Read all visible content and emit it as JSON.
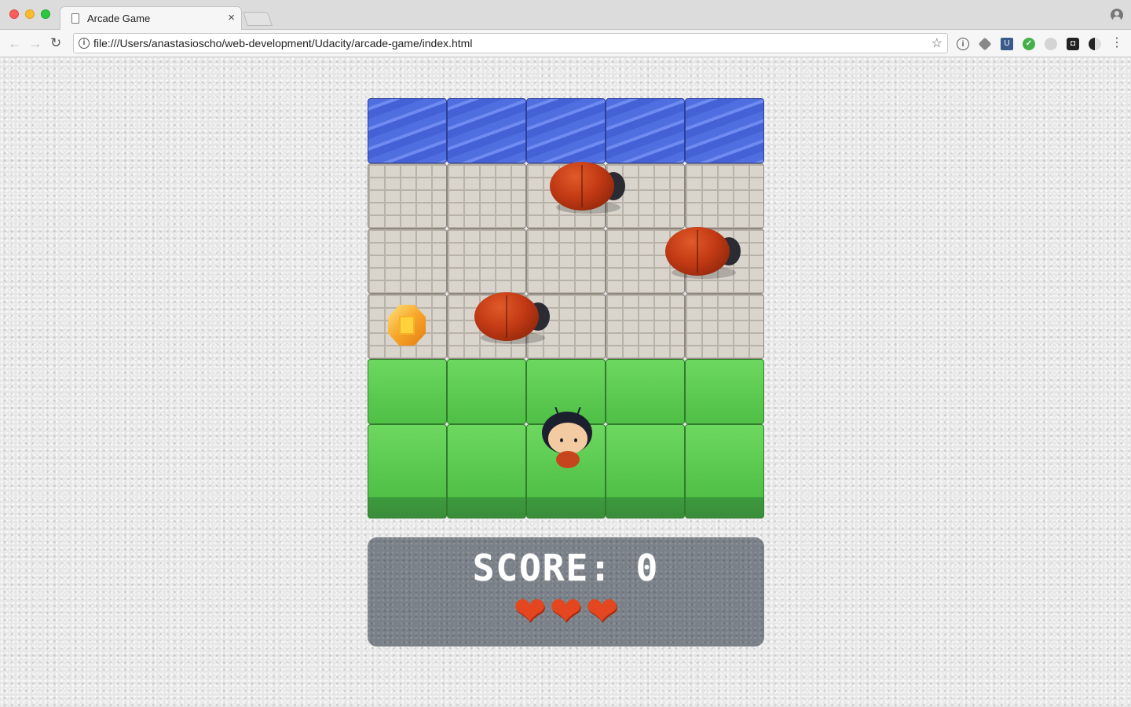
{
  "browser": {
    "tab_title": "Arcade Game",
    "tab_close": "×",
    "url": "file:///Users/anastasioscho/web-development/Udacity/arcade-game/index.html",
    "back_glyph": "←",
    "forward_glyph": "→",
    "reload_glyph": "↻",
    "star_glyph": "☆",
    "menu_glyph": "⋮",
    "info_glyph": "i"
  },
  "game": {
    "columns": 5,
    "rows": [
      "water",
      "stone",
      "stone",
      "stone",
      "grass",
      "grass"
    ],
    "enemies": [
      {
        "row": 1,
        "col": 2.3
      },
      {
        "row": 2,
        "col": 3.75
      },
      {
        "row": 3,
        "col": 1.35
      }
    ],
    "gem": {
      "row": 3,
      "col": 0,
      "color": "orange"
    },
    "player": {
      "row": 5,
      "col": 2
    }
  },
  "scoreboard": {
    "score_text": "SCORE: 0",
    "lives": 3,
    "heart_glyph": "❤"
  },
  "colors": {
    "water": "#4f6fe0",
    "stone": "#d9d4cc",
    "grass": "#5cc850",
    "enemy": "#c23a14",
    "scoreboard_bg": "#7b8188",
    "heart": "#e4471f"
  }
}
